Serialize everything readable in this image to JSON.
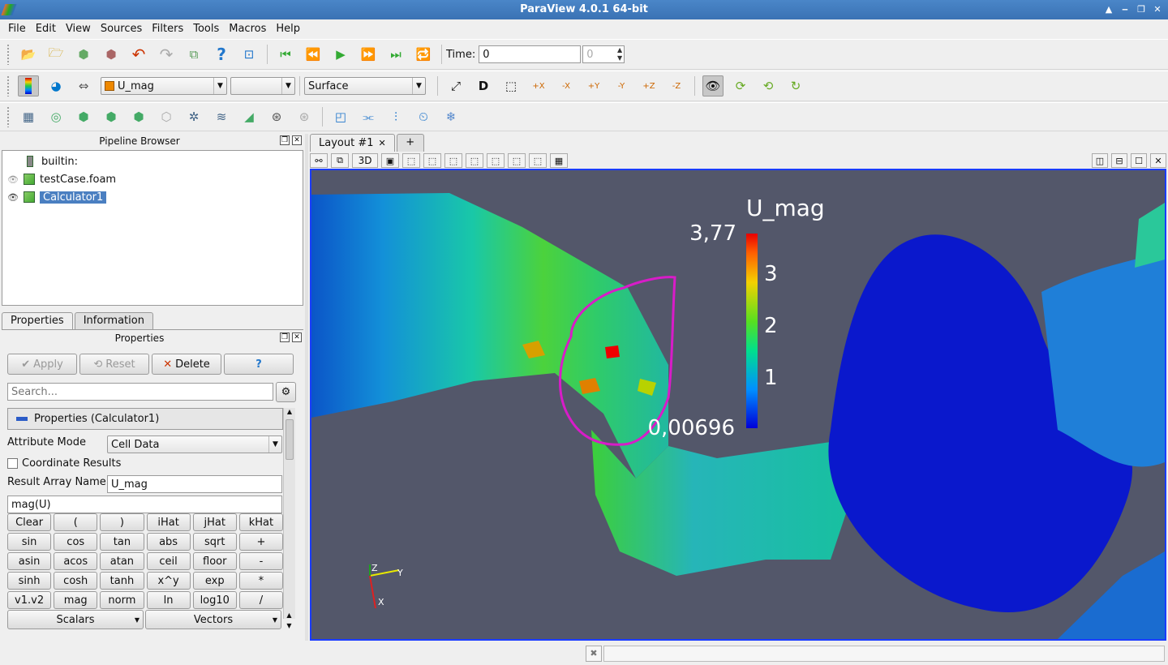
{
  "window": {
    "title": "ParaView 4.0.1 64-bit"
  },
  "menu": [
    "File",
    "Edit",
    "View",
    "Sources",
    "Filters",
    "Tools",
    "Macros",
    "Help"
  ],
  "time": {
    "label": "Time:",
    "value": "0",
    "step_value": "0"
  },
  "active_variable": "U_mag",
  "component": "",
  "representation": "Surface",
  "pipeline": {
    "title": "Pipeline Browser",
    "items": [
      {
        "label": "builtin:"
      },
      {
        "label": "testCase.foam"
      },
      {
        "label": "Calculator1"
      }
    ]
  },
  "bottom_tabs": [
    "Properties",
    "Information"
  ],
  "properties": {
    "title": "Properties",
    "apply": "Apply",
    "reset": "Reset",
    "delete": "Delete",
    "help": "?",
    "search_placeholder": "Search...",
    "section": "Properties (Calculator1)",
    "attribute_mode_label": "Attribute Mode",
    "attribute_mode_value": "Cell Data",
    "coordinate_results": "Coordinate Results",
    "result_name_label": "Result Array Name",
    "result_name_value": "U_mag",
    "expression": "mag(U)",
    "calc_buttons": [
      "Clear",
      "(",
      ")",
      "iHat",
      "jHat",
      "kHat",
      "sin",
      "cos",
      "tan",
      "abs",
      "sqrt",
      "+",
      "asin",
      "acos",
      "atan",
      "ceil",
      "floor",
      "-",
      "sinh",
      "cosh",
      "tanh",
      "x^y",
      "exp",
      "*",
      "v1.v2",
      "mag",
      "norm",
      "ln",
      "log10",
      "/"
    ],
    "scalars": "Scalars",
    "vectors": "Vectors"
  },
  "layout": {
    "tab": "Layout #1",
    "add": "+",
    "mode_3d": "3D"
  },
  "colorbar": {
    "title": "U_mag",
    "max": "3,77",
    "ticks": [
      "3",
      "2",
      "1"
    ],
    "min": "0,00696"
  },
  "axes": {
    "x": "X",
    "y": "Y",
    "z": "Z"
  }
}
